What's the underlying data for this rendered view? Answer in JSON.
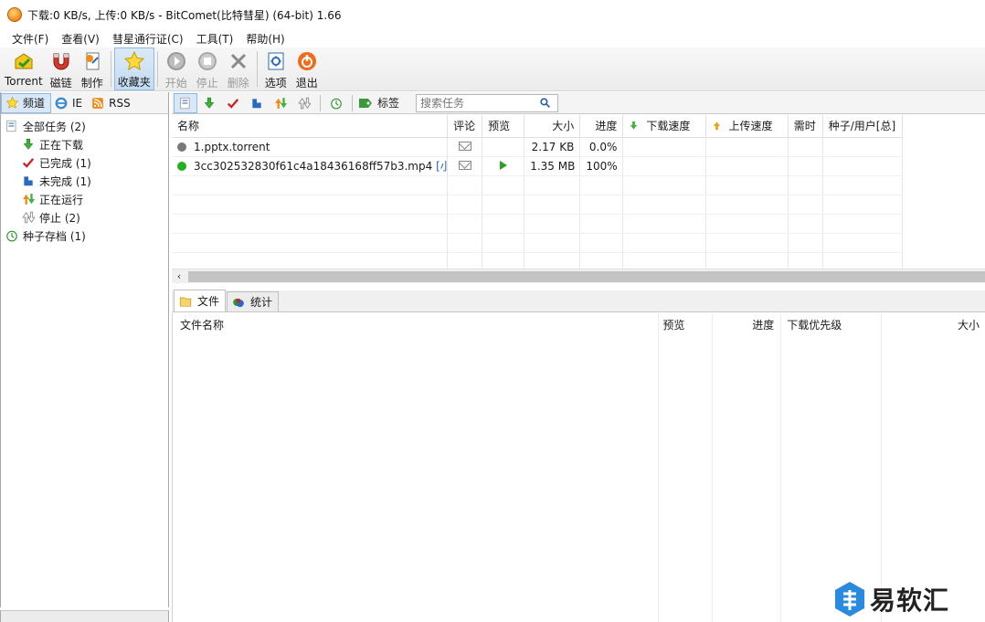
{
  "window": {
    "title": "下载:0 KB/s, 上传:0 KB/s - BitComet(比特彗星) (64-bit) 1.66"
  },
  "menubar": {
    "items": [
      "文件(F)",
      "查看(V)",
      "彗星通行证(C)",
      "工具(T)",
      "帮助(H)"
    ]
  },
  "toolbar": {
    "torrent": "Torrent",
    "magnet": "磁链",
    "make": "制作",
    "favorites": "收藏夹",
    "start": "开始",
    "stop": "停止",
    "delete": "删除",
    "options": "选项",
    "exit": "退出"
  },
  "sidebar": {
    "tabs": [
      "频道",
      "IE",
      "RSS"
    ],
    "tree": {
      "all": "全部任务 (2)",
      "downloading": "正在下载",
      "completed": "已完成 (1)",
      "incomplete": "未完成 (1)",
      "running": "正在运行",
      "stopped": "停止 (2)",
      "archive": "种子存档 (1)"
    }
  },
  "task_toolbar": {
    "tag_label": "标签",
    "search_placeholder": "搜索任务"
  },
  "task_list": {
    "columns": [
      "名称",
      "评论",
      "预览",
      "大小",
      "进度",
      "下载速度",
      "上传速度",
      "需时",
      "种子/用户[总]"
    ],
    "rows": [
      {
        "name": "1.pptx.torrent",
        "size": "2.17 KB",
        "progress": "0.0%",
        "status_color": "#7a7a7a"
      },
      {
        "name": "3cc302532830f61c4a18436168ff57b3.mp4",
        "name_suffix": "[小...",
        "size": "1.35 MB",
        "progress": "100%",
        "status_color": "#22b022"
      }
    ]
  },
  "detail_tabs": {
    "files": "文件",
    "stats": "统计"
  },
  "file_list": {
    "columns": [
      "文件名称",
      "预览",
      "进度",
      "下载优先级",
      "大小"
    ]
  },
  "watermark": {
    "text": "易软汇"
  }
}
